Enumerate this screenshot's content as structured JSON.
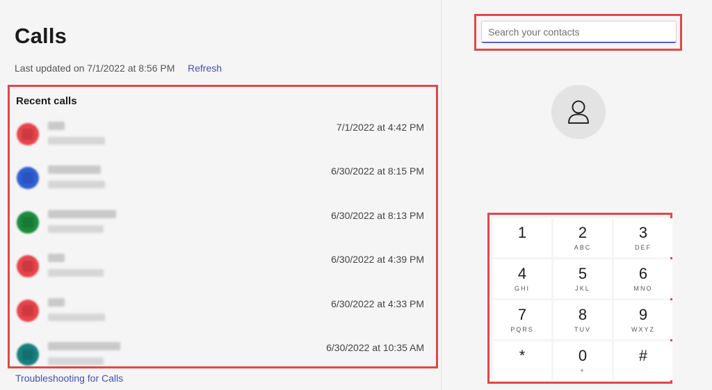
{
  "header": {
    "title": "Calls",
    "updated_text": "Last updated on 7/1/2022 at 8:56 PM",
    "refresh_label": "Refresh"
  },
  "recent": {
    "title": "Recent calls",
    "items": [
      {
        "time": "7/1/2022 at 4:42 PM",
        "avatar_color": "#e8434a"
      },
      {
        "time": "6/30/2022 at 8:15 PM",
        "avatar_color": "#2f5fd6"
      },
      {
        "time": "6/30/2022 at 8:13 PM",
        "avatar_color": "#1c8a3c"
      },
      {
        "time": "6/30/2022 at 4:39 PM",
        "avatar_color": "#e8434a"
      },
      {
        "time": "6/30/2022 at 4:33 PM",
        "avatar_color": "#e8434a"
      },
      {
        "time": "6/30/2022 at 10:35 AM",
        "avatar_color": "#17807f"
      }
    ]
  },
  "footer": {
    "troubleshoot_label": "Troubleshooting for Calls"
  },
  "search": {
    "placeholder": "Search your contacts"
  },
  "contact": {
    "icon": "person-icon"
  },
  "dialpad": {
    "keys": [
      {
        "digit": "1",
        "letters": ""
      },
      {
        "digit": "2",
        "letters": "ABC"
      },
      {
        "digit": "3",
        "letters": "DEF"
      },
      {
        "digit": "4",
        "letters": "GHI"
      },
      {
        "digit": "5",
        "letters": "JKL"
      },
      {
        "digit": "6",
        "letters": "MNO"
      },
      {
        "digit": "7",
        "letters": "PQRS"
      },
      {
        "digit": "8",
        "letters": "TUV"
      },
      {
        "digit": "9",
        "letters": "WXYZ"
      },
      {
        "digit": "*",
        "letters": ""
      },
      {
        "digit": "0",
        "letters": "+"
      },
      {
        "digit": "#",
        "letters": ""
      }
    ]
  },
  "colors": {
    "accent": "#5b5fc7",
    "link": "#464eb8",
    "highlight": "#e0474c"
  }
}
